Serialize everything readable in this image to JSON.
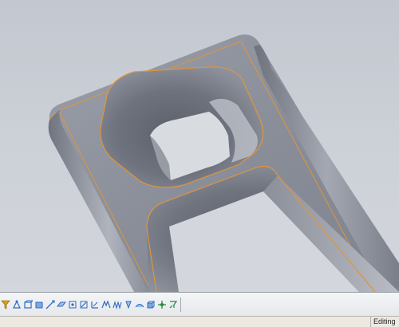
{
  "viewport": {
    "edge_color": "#e0953a",
    "background": "#c9ced6",
    "part_color": "#8e929e"
  },
  "toolbar": {
    "buttons": [
      {
        "icon": "select-filter-icon",
        "color": "#d9a300"
      },
      {
        "icon": "filter-vertices-icon",
        "color": "#2f6bbf"
      },
      {
        "icon": "filter-edges-icon",
        "color": "#2f6bbf"
      },
      {
        "icon": "filter-faces-icon",
        "color": "#2f6bbf"
      },
      {
        "icon": "filter-axes-icon",
        "color": "#2f6bbf"
      },
      {
        "icon": "filter-planes-icon",
        "color": "#2f6bbf"
      },
      {
        "icon": "filter-sketch-points-icon",
        "color": "#2f6bbf"
      },
      {
        "icon": "filter-sketch-segments-icon",
        "color": "#2f6bbf"
      },
      {
        "icon": "filter-dimensions-icon",
        "color": "#2f6bbf"
      },
      {
        "icon": "filter-notes-icon",
        "color": "#2f6bbf"
      },
      {
        "icon": "filter-welds-icon",
        "color": "#2f6bbf"
      },
      {
        "icon": "filter-datum-icon",
        "color": "#2f6bbf"
      },
      {
        "icon": "filter-surfaces-icon",
        "color": "#2f6bbf"
      },
      {
        "icon": "filter-solid-bodies-icon",
        "color": "#2f6bbf"
      },
      {
        "icon": "filter-routing-icon",
        "color": "#1f8a3a"
      },
      {
        "icon": "clear-filters-icon",
        "color": "#1f8a3a"
      }
    ]
  },
  "statusbar": {
    "mode_text": "Editing"
  }
}
